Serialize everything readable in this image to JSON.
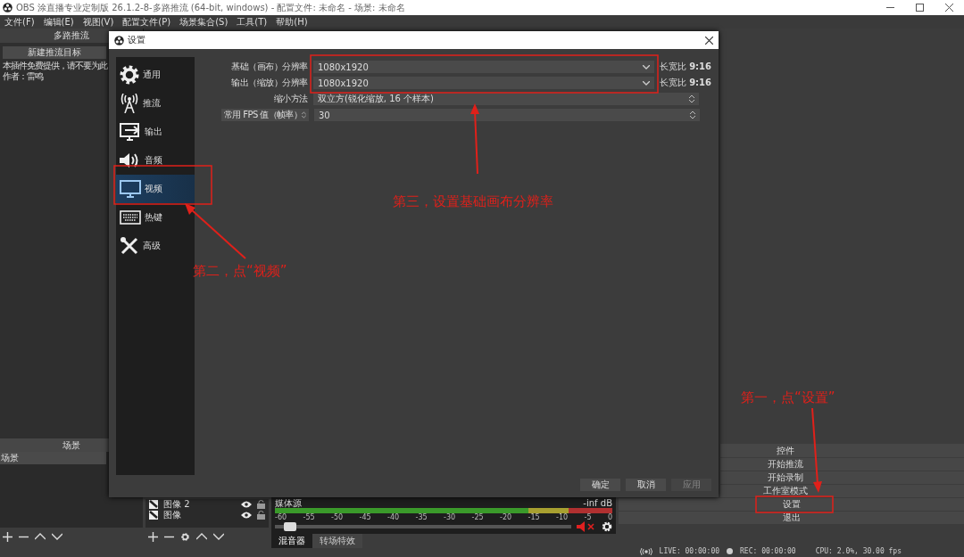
{
  "window": {
    "title": "OBS 涂直播专业定制版 26.1.2-8-多路推流 (64-bit, windows) - 配置文件: 未命名 - 场景: 未命名"
  },
  "menu": [
    "文件(F)",
    "编辑(E)",
    "视图(V)",
    "配置文件(P)",
    "场景集合(S)",
    "工具(T)",
    "帮助(H)"
  ],
  "multistream": {
    "title": "多路推流",
    "new_target_button": "新建推流目标",
    "notice": [
      "本插件免费提供，请不要为此",
      "作者：雷鸣"
    ]
  },
  "settings": {
    "title": "设置",
    "categories": [
      {
        "label": "通用",
        "selected": false
      },
      {
        "label": "推流",
        "selected": false
      },
      {
        "label": "输出",
        "selected": false
      },
      {
        "label": "音频",
        "selected": false
      },
      {
        "label": "视频",
        "selected": true
      },
      {
        "label": "热键",
        "selected": false
      },
      {
        "label": "高级",
        "selected": false
      }
    ],
    "fields": [
      {
        "kind": "dropdown",
        "label": "基础（画布）分辨率",
        "value": "1080x1920",
        "aspect_label": "长宽比",
        "aspect": "9:16"
      },
      {
        "kind": "dropdown",
        "label": "输出（缩放）分辨率",
        "value": "1080x1920",
        "aspect_label": "长宽比",
        "aspect": "9:16"
      },
      {
        "kind": "spin",
        "label": "缩小方法",
        "value": "双立方(锐化缩放, 16 个样本)"
      },
      {
        "kind": "spin-combo-label",
        "label": "常用 FPS 值（帧率）",
        "value": "30"
      }
    ],
    "buttons": [
      {
        "label": "确定",
        "disabled": false
      },
      {
        "label": "取消",
        "disabled": false
      },
      {
        "label": "应用",
        "disabled": true
      }
    ]
  },
  "scenes": {
    "title": "场景",
    "items": [
      {
        "label": "场景",
        "selected": true
      }
    ]
  },
  "sources": {
    "items": [
      "图像 2",
      "图像"
    ]
  },
  "mixer": {
    "source": "媒体源",
    "reading": "-inf dB",
    "ticks": [
      "-60",
      "-55",
      "-50",
      "-45",
      "-40",
      "-35",
      "-30",
      "-25",
      "-20",
      "-15",
      "-10",
      "-5",
      "0"
    ],
    "volume": {
      "level": 0.03
    },
    "muted": true,
    "tabs": [
      {
        "label": "混音器",
        "selected": true
      },
      {
        "label": "转场特效",
        "selected": false
      }
    ]
  },
  "controls": {
    "title": "控件",
    "buttons": [
      "开始推流",
      "开始录制",
      "工作室模式",
      "设置",
      "退出"
    ]
  },
  "status_bar": {
    "live": "LIVE: 00:00:00",
    "rec": "REC: 00:00:00",
    "cpu": "CPU: 2.0%, 30.00 fps"
  },
  "annotations": [
    {
      "kind": "note",
      "text": "第一，点“设置”"
    },
    {
      "kind": "note",
      "text": "第二，点“视频”"
    },
    {
      "kind": "note",
      "text": "第三，设置基础画布分辨率"
    }
  ]
}
